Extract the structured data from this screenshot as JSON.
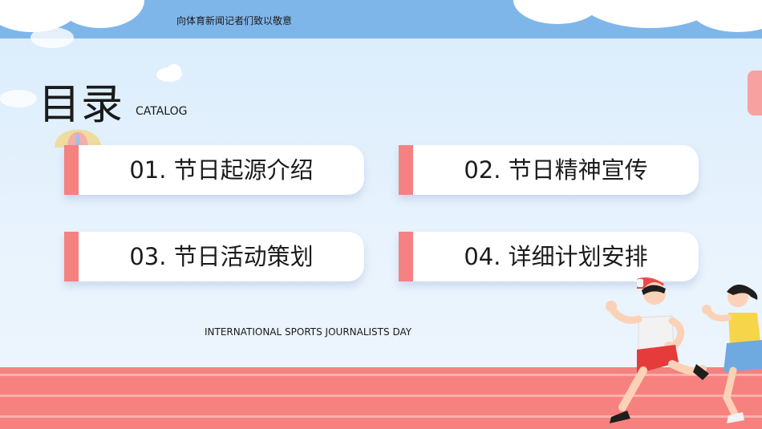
{
  "header": {
    "text": "向体育新闻记者们致以敬意"
  },
  "title": {
    "main": "目录",
    "sub": "CATALOG"
  },
  "items": [
    {
      "label": "01. 节日起源介绍"
    },
    {
      "label": "02. 节日精神宣传"
    },
    {
      "label": "03. 节日活动策划"
    },
    {
      "label": "04. 详细计划安排"
    }
  ],
  "footer": {
    "text": "INTERNATIONAL SPORTS JOURNALISTS DAY"
  },
  "colors": {
    "accent": "#f58181",
    "sky": "#7fb6ea",
    "track": "#f6817f",
    "background": "#e8f3fd"
  }
}
